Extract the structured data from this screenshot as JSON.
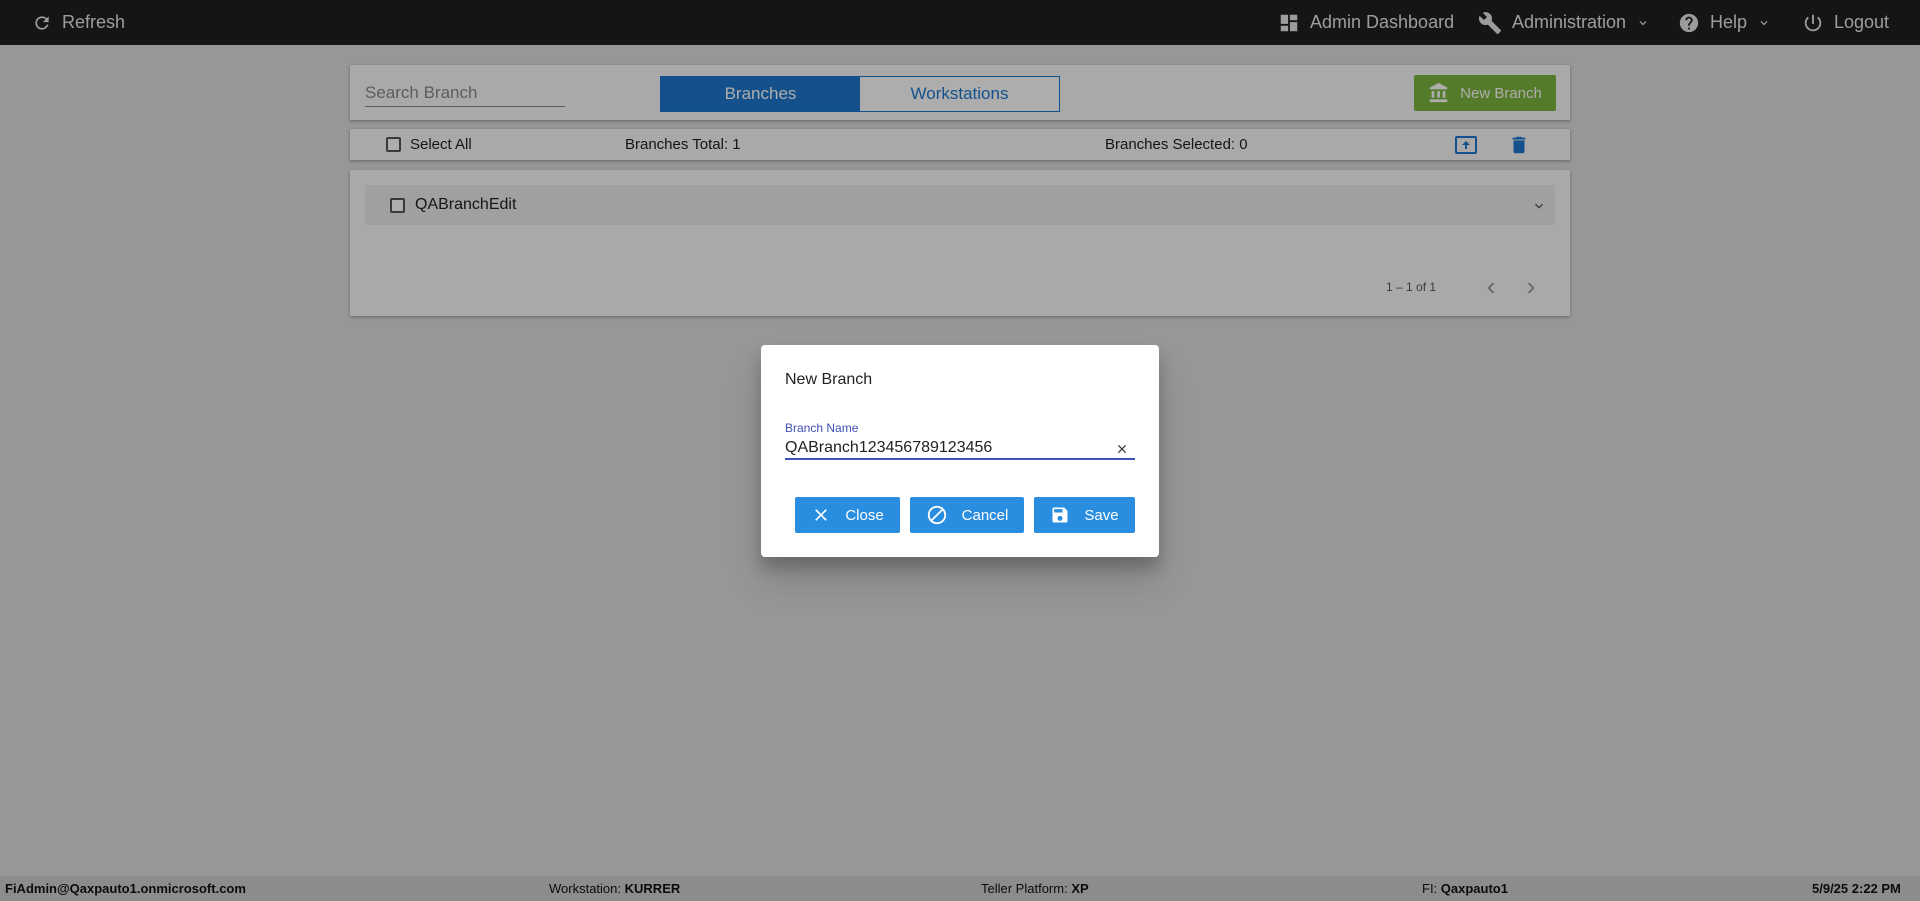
{
  "topbar": {
    "refresh_label": "Refresh",
    "dashboard_label": "Admin Dashboard",
    "administration_label": "Administration",
    "help_label": "Help",
    "logout_label": "Logout"
  },
  "search": {
    "placeholder": "Search Branch"
  },
  "tabs": [
    {
      "label": "Branches",
      "active": true
    },
    {
      "label": "Workstations",
      "active": false
    }
  ],
  "new_branch_label": "New Branch",
  "selection": {
    "select_all_label": "Select All",
    "total_text": "Branches Total: 1",
    "selected_text": "Branches Selected: 0"
  },
  "branches": [
    {
      "name": "QABranchEdit"
    }
  ],
  "pager": {
    "range_text": "1 – 1 of 1"
  },
  "dialog": {
    "title": "New Branch",
    "field_label": "Branch Name",
    "field_value": "QABranch123456789123456",
    "close_label": "Close",
    "cancel_label": "Cancel",
    "save_label": "Save"
  },
  "status": {
    "user": "FiAdmin@Qaxpauto1.onmicrosoft.com",
    "workstation_label": "Workstation:",
    "workstation_value": "KURRER",
    "platform_label": "Teller Platform:",
    "platform_value": "XP",
    "fi_label": "FI:",
    "fi_value": "Qaxpauto1",
    "datetime": "5/9/25 2:22 PM"
  },
  "colors": {
    "topbar": "#1f1f1f",
    "primary_blue": "#1e78cf",
    "button_blue": "#2a8ee0",
    "new_branch_green": "#7cb53f",
    "field_accent": "#3f51b5"
  },
  "icons": {
    "refresh": "refresh-icon",
    "dashboard": "dashboard-icon",
    "administration": "wrench-icon",
    "help": "help-icon",
    "logout": "power-icon",
    "new_branch": "bank-icon",
    "upload": "upload-icon",
    "delete": "trash-icon",
    "close": "close-icon",
    "cancel": "block-icon",
    "save": "floppy-icon"
  }
}
